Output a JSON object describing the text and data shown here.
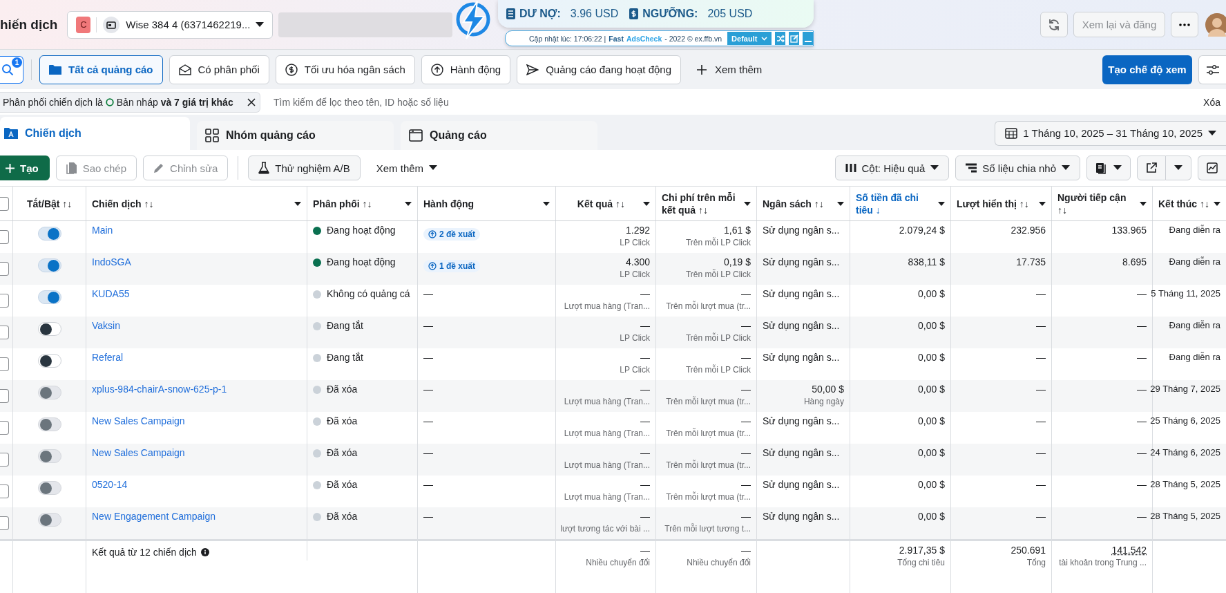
{
  "header": {
    "title": "hiến dịch",
    "account": {
      "badge": "C",
      "name": "Wise 384 4 (6371462219..."
    },
    "review_button": {
      "label": "Xem lại và đăng",
      "disabled": true
    }
  },
  "adscheck": {
    "debt_label": "DƯ NỢ:",
    "debt": "3.96 USD",
    "threshold_label": "NGƯỠNG:",
    "threshold": "205 USD",
    "updated": "Cập nhật lúc: 17:06:22 |",
    "brand": "Fast",
    "brand_accent": "AdsCheck",
    "copyright": "- 2022 © ex.ffb.vn",
    "preset": "Default"
  },
  "filter_bar": {
    "search_badge": "1",
    "chips": [
      {
        "label": "Tất cả quảng cáo",
        "selected": true
      },
      {
        "label": "Có phân phối",
        "selected": false
      },
      {
        "label": "Tối ưu hóa ngân sách",
        "selected": false
      },
      {
        "label": "Hành động",
        "selected": false
      },
      {
        "label": "Quảng cáo đang hoạt động",
        "selected": false
      }
    ],
    "more": "Xem thêm",
    "create_view": "Tạo chế độ xem"
  },
  "filter_line": {
    "field": "Phân phối chiến dịch là",
    "value": "Bản nháp **và 7 giá trị khác**",
    "placeholder": "Tìm kiếm để lọc theo tên, ID hoặc số liệu",
    "clear": "Xóa"
  },
  "tabs": [
    {
      "label": "Chiến dịch",
      "selected": true
    },
    {
      "label": "Nhóm quảng cáo",
      "selected": false
    },
    {
      "label": "Quảng cáo",
      "selected": false
    }
  ],
  "date_range": "1 Tháng 10, 2025 – 31 Tháng 10, 2025",
  "toolbar": {
    "buttons": [
      {
        "label": "Tạo",
        "kind": "primary",
        "disabled": false
      },
      {
        "label": "Sao chép",
        "kind": "plain",
        "disabled": true
      },
      {
        "label": "Chỉnh sửa",
        "kind": "plain",
        "disabled": true
      },
      {
        "label": "Thử nghiệm A/B",
        "kind": "plain",
        "disabled": false
      },
      {
        "label": "Xem thêm",
        "kind": "menu",
        "disabled": false
      }
    ],
    "columns_button": "Cột: Hiệu quả",
    "breakdown_button": "Số liệu chia nhỏ"
  },
  "table": {
    "select_all_checked": false,
    "columns": [
      {
        "label": "Tắt/Bật ↑↓",
        "sorted": false
      },
      {
        "label": "Chiến dịch ↑↓",
        "sorted": false
      },
      {
        "label": "Phân phối ↑↓",
        "sorted": false
      },
      {
        "label": "Hành động",
        "sorted": false
      },
      {
        "label": "Kết quả ↑↓",
        "sorted": false
      },
      {
        "label": "Chi phí trên mỗi kết quả ↑↓",
        "sorted": false
      },
      {
        "label": "Ngân sách ↑↓",
        "sorted": false
      },
      {
        "label": "Số tiền đã chi tiêu ↓",
        "sorted": true
      },
      {
        "label": "Lượt hiển thị ↑↓",
        "sorted": false
      },
      {
        "label": "Người tiếp cận ↑↓",
        "sorted": false
      },
      {
        "label": "Kết thúc ↑↓",
        "sorted": false
      }
    ],
    "rows": [
      {
        "checked": false,
        "on": true,
        "disabled": false,
        "name": "Main",
        "status": "Đang hoạt động",
        "color": "#0a7050",
        "suggestion": "2 đề xuất",
        "result": "1.292",
        "result_sub": "LP Click",
        "cost": "1,61 $",
        "cost_sub": "Trên mỗi LP Click",
        "budget": "Sử dụng ngân s...",
        "spent": "2.079,24 $",
        "impressions": "232.956",
        "reach": "133.965",
        "end": "Đang diễn ra"
      },
      {
        "checked": false,
        "on": true,
        "disabled": false,
        "name": "IndoSGA",
        "status": "Đang hoạt động",
        "color": "#0a7050",
        "suggestion": "1 đề xuất",
        "result": "4.300",
        "result_sub": "LP Click",
        "cost": "0,19 $",
        "cost_sub": "Trên mỗi LP Click",
        "budget": "Sử dụng ngân s...",
        "spent": "838,11 $",
        "impressions": "17.735",
        "reach": "8.695",
        "end": "Đang diễn ra"
      },
      {
        "checked": false,
        "on": true,
        "disabled": false,
        "name": "KUDA55",
        "status": "Không có quảng cá",
        "color": "#cbd2d9",
        "action": "—",
        "result": "—",
        "result_sub": "Lượt mua hàng (Tran...",
        "cost": "—",
        "cost_sub": "Trên mỗi lượt mua (tr...",
        "budget": "Sử dụng ngân s...",
        "spent": "0,00 $",
        "impressions": "—",
        "reach": "—",
        "end": "5 Tháng 11, 2025"
      },
      {
        "checked": false,
        "on": false,
        "disabled": false,
        "name": "Vaksin",
        "status": "Đang tắt",
        "color": "#cbd2d9",
        "action": "—",
        "result": "—",
        "result_sub": "LP Click",
        "cost": "—",
        "cost_sub": "Trên mỗi LP Click",
        "budget": "Sử dụng ngân s...",
        "spent": "0,00 $",
        "impressions": "—",
        "reach": "—",
        "end": "Đang diễn ra"
      },
      {
        "checked": false,
        "on": false,
        "disabled": false,
        "name": "Referal",
        "status": "Đang tắt",
        "color": "#cbd2d9",
        "action": "—",
        "result": "—",
        "result_sub": "LP Click",
        "cost": "—",
        "cost_sub": "Trên mỗi LP Click",
        "budget": "Sử dụng ngân s...",
        "spent": "0,00 $",
        "impressions": "—",
        "reach": "—",
        "end": "Đang diễn ra"
      },
      {
        "checked": false,
        "on": false,
        "disabled": true,
        "name": "xplus-984-chairA-snow-625-p-1",
        "status": "Đã xóa",
        "color": "#cbd2d9",
        "action": "—",
        "result": "—",
        "result_sub": "Lượt mua hàng (Tran...",
        "cost": "—",
        "cost_sub": "Trên mỗi lượt mua (tr...",
        "budget": "50,00 $",
        "budget_sub": "Hàng ngày",
        "spent": "0,00 $",
        "impressions": "—",
        "reach": "—",
        "end": "29 Tháng 7, 2025"
      },
      {
        "checked": false,
        "on": false,
        "disabled": true,
        "name": "New Sales Campaign",
        "status": "Đã xóa",
        "color": "#cbd2d9",
        "action": "—",
        "result": "—",
        "result_sub": "Lượt mua hàng (Tran...",
        "cost": "—",
        "cost_sub": "Trên mỗi lượt mua (tr...",
        "budget": "Sử dụng ngân s...",
        "spent": "0,00 $",
        "impressions": "—",
        "reach": "—",
        "end": "25 Tháng 6, 2025"
      },
      {
        "checked": false,
        "on": false,
        "disabled": true,
        "name": "New Sales Campaign",
        "status": "Đã xóa",
        "color": "#cbd2d9",
        "action": "—",
        "result": "—",
        "result_sub": "Lượt mua hàng (Tran...",
        "cost": "—",
        "cost_sub": "Trên mỗi lượt mua (tr...",
        "budget": "Sử dụng ngân s...",
        "spent": "0,00 $",
        "impressions": "—",
        "reach": "—",
        "end": "24 Tháng 6, 2025"
      },
      {
        "checked": false,
        "on": false,
        "disabled": true,
        "name": "0520-14",
        "status": "Đã xóa",
        "color": "#cbd2d9",
        "action": "—",
        "result": "—",
        "result_sub": "Lượt mua hàng (Tran...",
        "cost": "—",
        "cost_sub": "Trên mỗi lượt mua (tr...",
        "budget": "Sử dụng ngân s...",
        "spent": "0,00 $",
        "impressions": "—",
        "reach": "—",
        "end": "28 Tháng 5, 2025"
      },
      {
        "checked": false,
        "on": false,
        "disabled": true,
        "name": "New Engagement Campaign",
        "status": "Đã xóa",
        "color": "#cbd2d9",
        "action": "—",
        "result": "—",
        "result_sub": "lượt tương tác với bài ...",
        "cost": "—",
        "cost_sub": "Trên mỗi lượt tương t...",
        "budget": "Sử dụng ngân s...",
        "spent": "0,00 $",
        "impressions": "—",
        "reach": "—",
        "end": "28 Tháng 5, 2025"
      }
    ],
    "footer": {
      "label": "Kết quả từ 12 chiến dịch",
      "result": "—",
      "result_sub": "Nhiều chuyển đổi",
      "cost": "—",
      "cost_sub": "Nhiều chuyển đổi",
      "spent": "2.917,35 $",
      "spent_sub": "Tổng chi tiêu",
      "impressions": "250.691",
      "impressions_sub": "Tổng",
      "reach": "141.542",
      "reach_sub": "tài khoản trong Trung ..."
    }
  }
}
